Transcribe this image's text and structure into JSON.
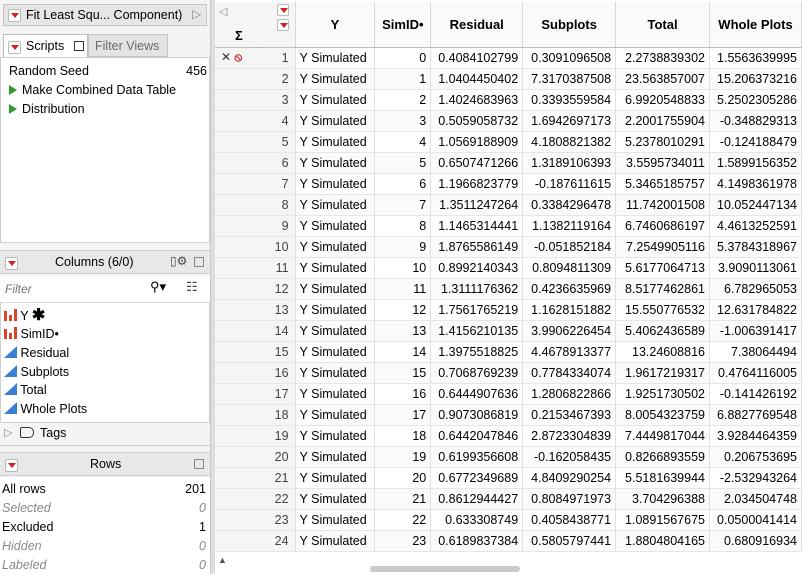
{
  "window": {
    "title": "Fit Least Squ... Component)"
  },
  "tabs": {
    "scripts": "Scripts",
    "filter_views": "Filter Views"
  },
  "scripts": [
    {
      "label": "Random Seed",
      "value": "456"
    },
    {
      "label": "Make Combined Data Table"
    },
    {
      "label": "Distribution"
    }
  ],
  "columns_panel": {
    "title": "Columns (6/0)",
    "filter_placeholder": "Filter",
    "items": [
      {
        "name": "Y",
        "icon": "nominal-bar-icon",
        "marker": "✱"
      },
      {
        "name": "SimID•",
        "icon": "nominal-bar-icon"
      },
      {
        "name": "Residual",
        "icon": "continuous-triangle-icon"
      },
      {
        "name": "Subplots",
        "icon": "continuous-triangle-icon"
      },
      {
        "name": "Total",
        "icon": "continuous-triangle-icon"
      },
      {
        "name": "Whole Plots",
        "icon": "continuous-triangle-icon"
      }
    ],
    "tags": "Tags"
  },
  "rows_panel": {
    "title": "Rows",
    "stats": [
      {
        "label": "All rows",
        "value": "201",
        "style": "normal"
      },
      {
        "label": "Selected",
        "value": "0",
        "style": "italic"
      },
      {
        "label": "Excluded",
        "value": "1",
        "style": "normal"
      },
      {
        "label": "Hidden",
        "value": "0",
        "style": "italic"
      },
      {
        "label": "Labeled",
        "value": "0",
        "style": "italic"
      }
    ]
  },
  "table": {
    "headers": [
      "Y",
      "SimID•",
      "Residual",
      "Subplots",
      "Total",
      "Whole Plots"
    ],
    "rows": [
      [
        "1",
        "Y Simulated",
        "0",
        "0.4084102799",
        "0.3091096508",
        "2.2738839302",
        "1.5563639995"
      ],
      [
        "2",
        "Y Simulated",
        "1",
        "1.0404450402",
        "7.3170387508",
        "23.563857007",
        "15.206373216"
      ],
      [
        "3",
        "Y Simulated",
        "2",
        "1.4024683963",
        "0.3393559584",
        "6.9920548833",
        "5.2502305286"
      ],
      [
        "4",
        "Y Simulated",
        "3",
        "0.5059058732",
        "1.6942697173",
        "2.2001755904",
        "-0.348829313"
      ],
      [
        "5",
        "Y Simulated",
        "4",
        "1.0569188909",
        "4.1808821382",
        "5.2378010291",
        "-0.124188479"
      ],
      [
        "6",
        "Y Simulated",
        "5",
        "0.6507471266",
        "1.3189106393",
        "3.5595734011",
        "1.5899156352"
      ],
      [
        "7",
        "Y Simulated",
        "6",
        "1.1966823779",
        "-0.187611615",
        "5.3465185757",
        "4.1498361978"
      ],
      [
        "8",
        "Y Simulated",
        "7",
        "1.3511247264",
        "0.3384296478",
        "11.742001508",
        "10.052447134"
      ],
      [
        "9",
        "Y Simulated",
        "8",
        "1.1465314441",
        "1.1382119164",
        "6.7460686197",
        "4.4613252591"
      ],
      [
        "10",
        "Y Simulated",
        "9",
        "1.8765586149",
        "-0.051852184",
        "7.2549905116",
        "5.3784318967"
      ],
      [
        "11",
        "Y Simulated",
        "10",
        "0.8992140343",
        "0.8094811309",
        "5.6177064713",
        "3.9090113061"
      ],
      [
        "12",
        "Y Simulated",
        "11",
        "1.3111176362",
        "0.4236635969",
        "8.5177462861",
        "6.782965053"
      ],
      [
        "13",
        "Y Simulated",
        "12",
        "1.7561765219",
        "1.1628151882",
        "15.550776532",
        "12.631784822"
      ],
      [
        "14",
        "Y Simulated",
        "13",
        "1.4156210135",
        "3.9906226454",
        "5.4062436589",
        "-1.006391417"
      ],
      [
        "15",
        "Y Simulated",
        "14",
        "1.3975518825",
        "4.4678913377",
        "13.24608816",
        "7.38064494"
      ],
      [
        "16",
        "Y Simulated",
        "15",
        "0.7068769239",
        "0.7784334074",
        "1.9617219317",
        "0.4764116005"
      ],
      [
        "17",
        "Y Simulated",
        "16",
        "0.6444907636",
        "1.2806822866",
        "1.9251730502",
        "-0.141426192"
      ],
      [
        "18",
        "Y Simulated",
        "17",
        "0.9073086819",
        "0.2153467393",
        "8.0054323759",
        "6.8827769548"
      ],
      [
        "19",
        "Y Simulated",
        "18",
        "0.6442047846",
        "2.8723304839",
        "7.4449817044",
        "3.9284464359"
      ],
      [
        "20",
        "Y Simulated",
        "19",
        "0.6199356608",
        "-0.162058435",
        "0.8266893559",
        "0.206753695"
      ],
      [
        "21",
        "Y Simulated",
        "20",
        "0.6772349689",
        "4.8409290254",
        "5.5181639944",
        "-2.532943264"
      ],
      [
        "22",
        "Y Simulated",
        "21",
        "0.8612944427",
        "0.8084971973",
        "3.704296388",
        "2.034504748"
      ],
      [
        "23",
        "Y Simulated",
        "22",
        "0.633308749",
        "0.4058438771",
        "1.0891567675",
        "0.0500041414"
      ],
      [
        "24",
        "Y Simulated",
        "23",
        "0.6189837384",
        "0.5805797441",
        "1.8804804165",
        "0.680916934"
      ]
    ]
  },
  "colors": {
    "red_triangle": "#d32020",
    "nominal_icon": "#d9452b",
    "continuous_icon": "#3b7fd4",
    "excluded_mark": "#d32020"
  }
}
